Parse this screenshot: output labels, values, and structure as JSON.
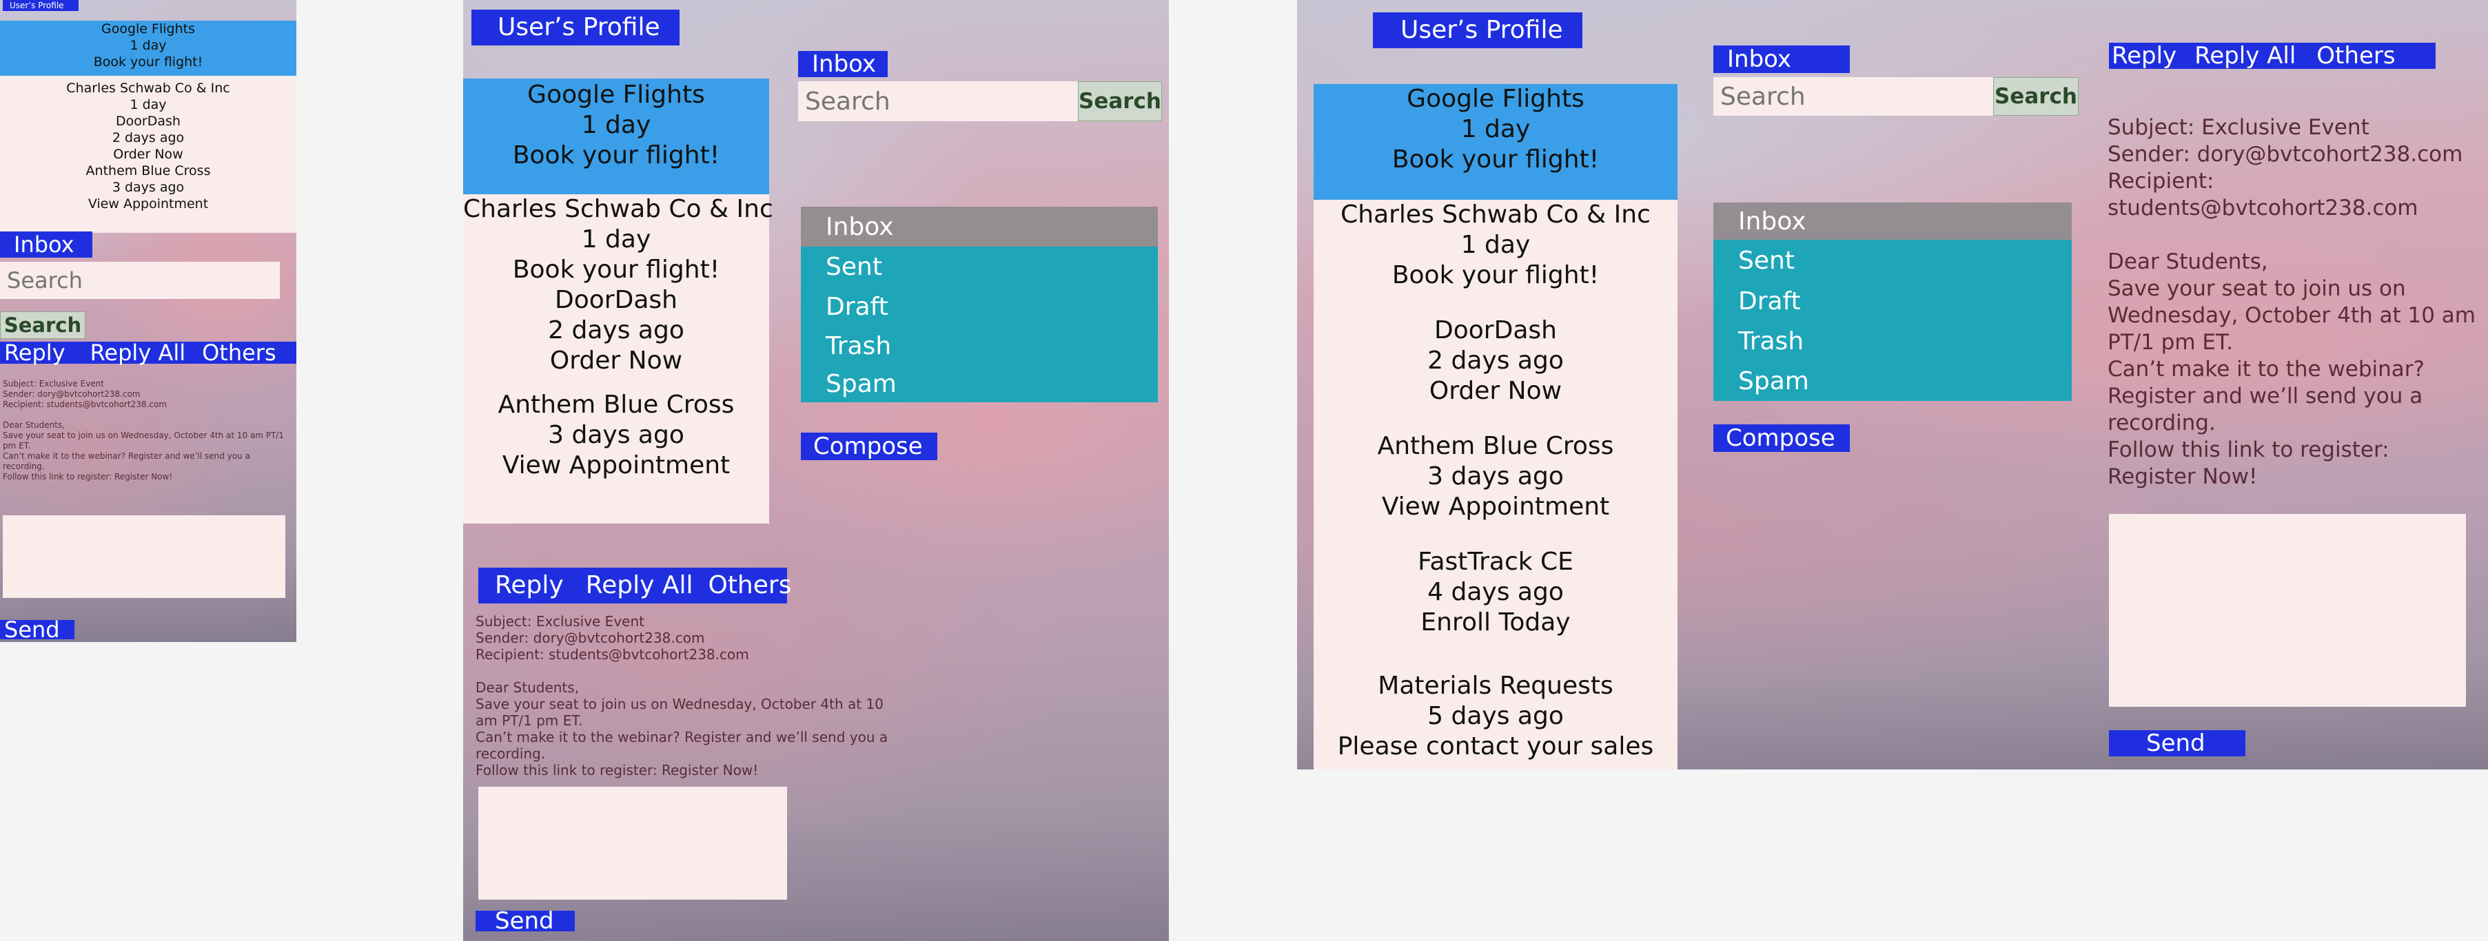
{
  "header": {
    "profile_label": "User’s Profile"
  },
  "folders": {
    "title": "Inbox",
    "items": [
      "Inbox",
      "Sent",
      "Draft",
      "Trash",
      "Spam"
    ]
  },
  "search": {
    "placeholder": "Search",
    "button_label": "Search"
  },
  "compose_label": "Compose",
  "emails": [
    {
      "sender": "Google Flights",
      "time": "1 day",
      "preview": "Book your flight!"
    },
    {
      "sender": "Charles Schwab Co & Inc",
      "time": "1 day",
      "preview": "Book your flight!"
    },
    {
      "sender": "DoorDash",
      "time": "2 days ago",
      "preview": "Order Now"
    },
    {
      "sender": "Anthem Blue Cross",
      "time": "3 days ago",
      "preview": "View Appointment"
    },
    {
      "sender": "FastTrack CE",
      "time": "4 days ago",
      "preview": "Enroll Today"
    },
    {
      "sender": "Materials Requests",
      "time": "5 days ago",
      "preview": "Please contact your sales"
    }
  ],
  "actions": {
    "reply": "Reply",
    "reply_all": "Reply All",
    "others": "Others",
    "send": "Send"
  },
  "message": {
    "subject": "Subject: Exclusive Event",
    "sender": "Sender: dory@bvtcohort238.com",
    "recipient": "Recipient: students@bvtcohort238.com",
    "greeting": "Dear Students,",
    "line1": "Save your seat to join us on Wednesday, October 4th at 10 am PT/1 pm ET.",
    "line2": "Can’t make it to the webinar? Register and we’ll send you a recording.",
    "line3": "Follow this link to register: Register Now!",
    "line2a": "Can’t make it to the webinar?",
    "line2b": "Register and we’ll send you a recording.",
    "line3a": "Follow this link to register:",
    "line3b": "Register Now!"
  },
  "colors": {
    "accent_blue": "#1f2fe0",
    "selected_mail": "#3a9fe8",
    "folder_teal": "#1ea6b8",
    "active_folder_grey": "#948d92",
    "panel_pink": "#f9eceb"
  }
}
